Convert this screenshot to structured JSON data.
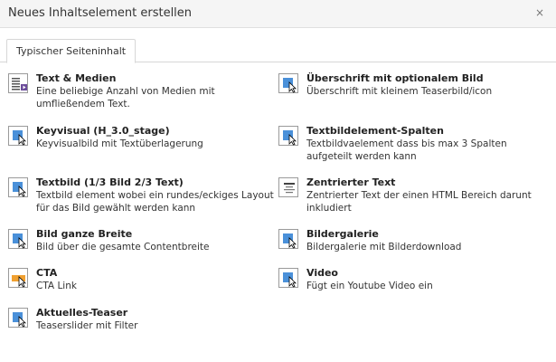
{
  "dialog": {
    "title": "Neues Inhaltselement erstellen",
    "close_label": "×"
  },
  "tabs": [
    {
      "label": "Typischer Seiteninhalt"
    }
  ],
  "items": [
    {
      "title": "Text & Medien",
      "desc": "Eine beliebige Anzahl von Medien mit umfließendem Text.",
      "icon": "text-media-icon"
    },
    {
      "title": "Überschrift mit optionalem Bild",
      "desc": "Überschrift mit kleinem Teaserbild/icon",
      "icon": "image-element-icon"
    },
    {
      "title": "Keyvisual (H_3.0_stage)",
      "desc": "Keyvisualbild mit Textüberlagerung",
      "icon": "image-element-icon"
    },
    {
      "title": "Textbildelement-Spalten",
      "desc": "Textbildvaelement dass bis max 3 Spalten aufgeteilt werden kann",
      "icon": "image-element-icon"
    },
    {
      "title": "Textbild (1/3 Bild 2/3 Text)",
      "desc": "Textbild element wobei ein rundes/eckiges Layout für das Bild gewählt werden kann",
      "icon": "image-element-icon"
    },
    {
      "title": "Zentrierter Text",
      "desc": "Zentrierter Text der einen HTML Bereich darunt inkludiert",
      "icon": "centered-text-icon"
    },
    {
      "title": "Bild ganze Breite",
      "desc": "Bild über die gesamte Contentbreite",
      "icon": "image-element-icon"
    },
    {
      "title": "Bildergalerie",
      "desc": "Bildergalerie mit Bilderdownload",
      "icon": "image-element-icon"
    },
    {
      "title": "CTA",
      "desc": "CTA Link",
      "icon": "cta-icon"
    },
    {
      "title": "Video",
      "desc": "Fügt ein Youtube Video ein",
      "icon": "image-element-icon"
    },
    {
      "title": "Aktuelles-Teaser",
      "desc": "Teaserslider mit Filter",
      "icon": "image-element-icon"
    }
  ],
  "colors": {
    "accent_blue": "#4a90d9",
    "media_purple": "#6b4c9a",
    "cta_orange": "#f0a030"
  }
}
